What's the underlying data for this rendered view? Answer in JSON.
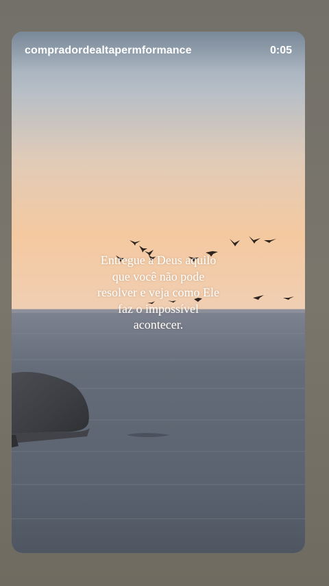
{
  "story": {
    "username": "compradordealtapermformance",
    "elapsed_time": "0:05",
    "quote_lines": [
      "Entregue a Deus aquilo",
      "que você não pode",
      "resolver e veja como Ele",
      "faz o impossível",
      "acontecer."
    ]
  },
  "colors": {
    "sky_top": "#93a5b8",
    "sky_horizon": "#f2c9a2",
    "sea": "#5d6673",
    "page_background": "#6d6a60"
  }
}
